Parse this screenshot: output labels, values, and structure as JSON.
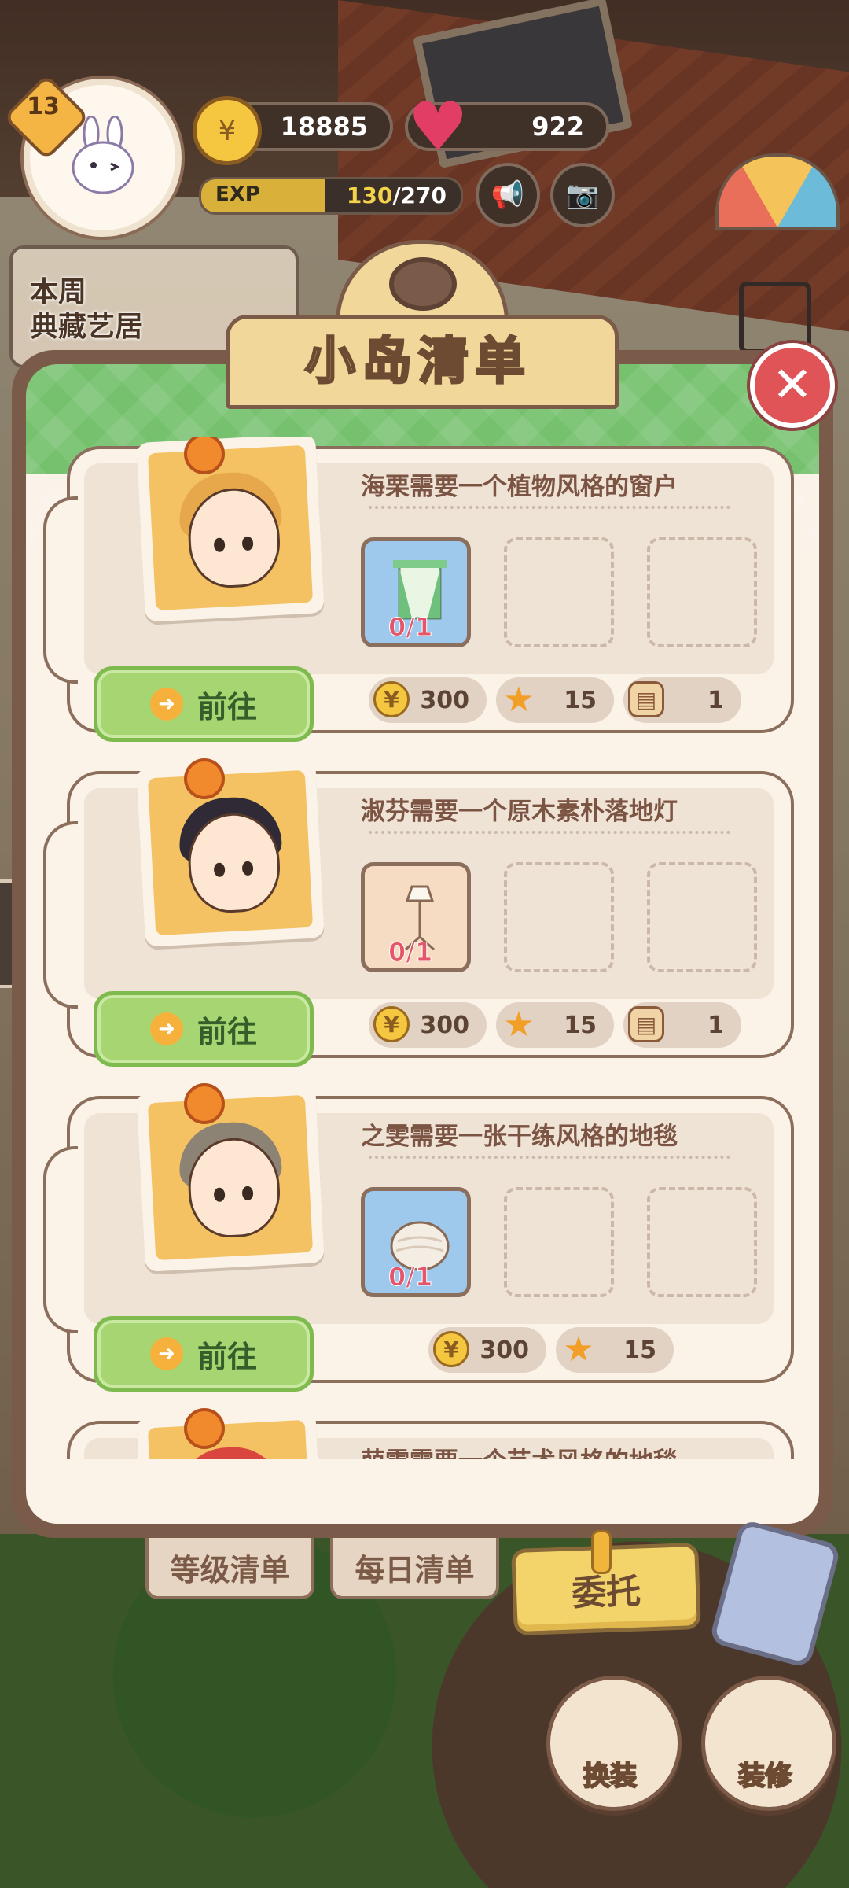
{
  "hud": {
    "level": "13",
    "coins": "18885",
    "hearts": "922",
    "exp_label": "EXP",
    "exp_current": "130",
    "exp_max": "/270",
    "exp_fraction": 0.48,
    "weekly_line1": "本周",
    "weekly_line2": "典藏艺居"
  },
  "modal": {
    "title": "小岛清单",
    "close_icon": "close-icon",
    "tasks": [
      {
        "text": "海栗需要一个植物风格的窗户",
        "slot_count_current": "0",
        "slot_count_total": "/1",
        "go_label": "前往",
        "reward_coins": "300",
        "reward_stars": "15",
        "reward_box": "1",
        "hair_color": "#e7a84b"
      },
      {
        "text": "淑芬需要一个原木素朴落地灯",
        "slot_count_current": "0",
        "slot_count_total": "/1",
        "go_label": "前往",
        "reward_coins": "300",
        "reward_stars": "15",
        "reward_box": "1",
        "hair_color": "#2f2a35"
      },
      {
        "text": "之雯需要一张干练风格的地毯",
        "slot_count_current": "0",
        "slot_count_total": "/1",
        "go_label": "前往",
        "reward_coins": "300",
        "reward_stars": "15",
        "hair_color": "#8d8374"
      },
      {
        "text": "萌雯需要一个艺术风格的地毯"
      }
    ]
  },
  "nav": {
    "level_list": "等级清单",
    "daily_list": "每日清单",
    "entrust": "委托",
    "outfit": "换装",
    "decorate": "装修"
  }
}
